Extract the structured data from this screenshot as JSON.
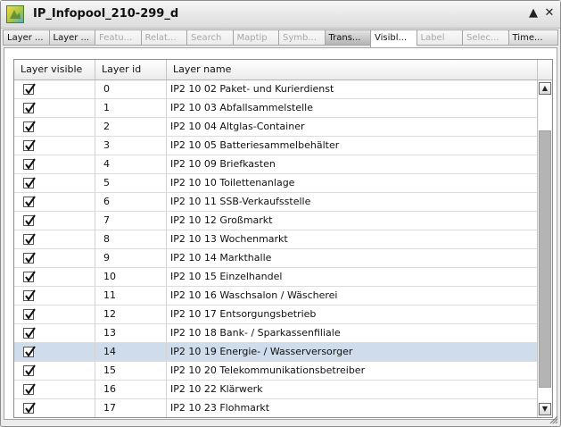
{
  "window": {
    "title": "IP_Infopool_210-299_d",
    "collapse_glyph": "▲",
    "close_glyph": "✕"
  },
  "tabs": [
    {
      "label": "Layer ...",
      "state": "normal"
    },
    {
      "label": "Layer ...",
      "state": "normal"
    },
    {
      "label": "Featu...",
      "state": "disabled"
    },
    {
      "label": "Relat...",
      "state": "disabled"
    },
    {
      "label": "Search",
      "state": "disabled"
    },
    {
      "label": "Maptip",
      "state": "disabled"
    },
    {
      "label": "Symb...",
      "state": "disabled"
    },
    {
      "label": "Trans...",
      "state": "dark"
    },
    {
      "label": "Visibl...",
      "state": "active"
    },
    {
      "label": "Label",
      "state": "disabled"
    },
    {
      "label": "Selec...",
      "state": "disabled"
    },
    {
      "label": "Time...",
      "state": "normal"
    }
  ],
  "table": {
    "columns": [
      "Layer visible",
      "Layer id",
      "Layer name"
    ],
    "rows": [
      {
        "visible": true,
        "id": "0",
        "name": "IP2 10 02 Paket- und Kurierdienst"
      },
      {
        "visible": true,
        "id": "1",
        "name": "IP2 10 03 Abfallsammelstelle"
      },
      {
        "visible": true,
        "id": "2",
        "name": "IP2 10 04 Altglas-Container"
      },
      {
        "visible": true,
        "id": "3",
        "name": "IP2 10 05 Batteriesammelbehälter"
      },
      {
        "visible": true,
        "id": "4",
        "name": "IP2 10 09 Briefkasten"
      },
      {
        "visible": true,
        "id": "5",
        "name": "IP2 10 10 Toilettenanlage"
      },
      {
        "visible": true,
        "id": "6",
        "name": "IP2 10 11 SSB-Verkaufsstelle"
      },
      {
        "visible": true,
        "id": "7",
        "name": "IP2 10 12 Großmarkt"
      },
      {
        "visible": true,
        "id": "8",
        "name": "IP2 10 13 Wochenmarkt"
      },
      {
        "visible": true,
        "id": "9",
        "name": "IP2 10 14 Markthalle"
      },
      {
        "visible": true,
        "id": "10",
        "name": "IP2 10 15 Einzelhandel"
      },
      {
        "visible": true,
        "id": "11",
        "name": "IP2 10 16 Waschsalon / Wäscherei"
      },
      {
        "visible": true,
        "id": "12",
        "name": "IP2 10 17 Entsorgungsbetrieb"
      },
      {
        "visible": true,
        "id": "13",
        "name": "IP2 10 18 Bank- / Sparkassenfiliale"
      },
      {
        "visible": true,
        "id": "14",
        "name": "IP2 10 19 Energie- / Wasserversorger",
        "selected": true
      },
      {
        "visible": true,
        "id": "15",
        "name": "IP2 10 20 Telekommunikationsbetreiber"
      },
      {
        "visible": true,
        "id": "16",
        "name": "IP2 10 22 Klärwerk"
      },
      {
        "visible": true,
        "id": "17",
        "name": "IP2 10 23 Flohmarkt"
      }
    ]
  },
  "scrollbar": {
    "up_glyph": "▲",
    "down_glyph": "▼"
  },
  "colors": {
    "selected_row": "#cfdcec",
    "active_tab": "#ffffff"
  }
}
